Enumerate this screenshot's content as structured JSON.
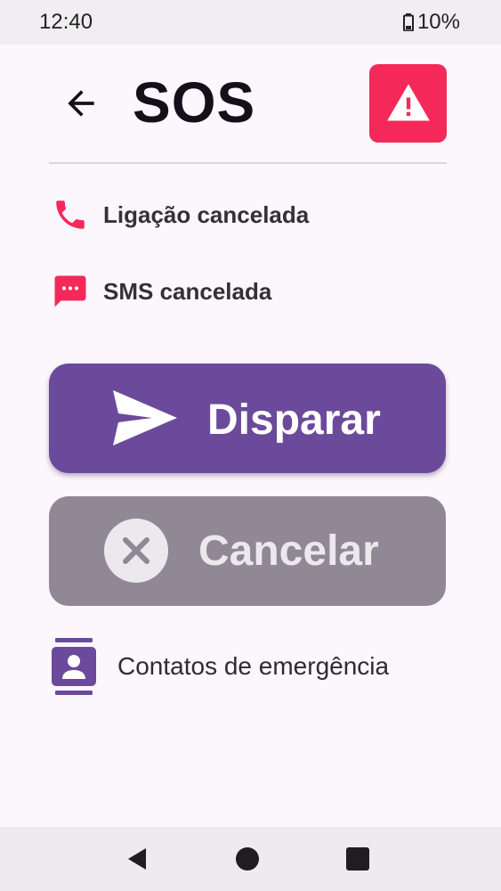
{
  "status_bar": {
    "time": "12:40",
    "battery": "10%"
  },
  "header": {
    "title": "SOS",
    "back_icon": "arrow-left-icon",
    "alert_icon": "warning-triangle-icon"
  },
  "colors": {
    "accent_red": "#f4295a",
    "primary_purple": "#6b4a9b",
    "disabled_grey": "#918896"
  },
  "statuses": [
    {
      "icon": "phone-icon",
      "label": "Ligação cancelada"
    },
    {
      "icon": "sms-icon",
      "label": "SMS cancelada"
    }
  ],
  "buttons": {
    "trigger": {
      "icon": "send-icon",
      "label": "Disparar"
    },
    "cancel": {
      "icon": "close-circle-icon",
      "label": "Cancelar"
    }
  },
  "contacts": {
    "icon": "contacts-icon",
    "label": "Contatos de emergência"
  },
  "nav": {
    "back": "back-triangle-icon",
    "home": "home-circle-icon",
    "recents": "recents-square-icon"
  }
}
